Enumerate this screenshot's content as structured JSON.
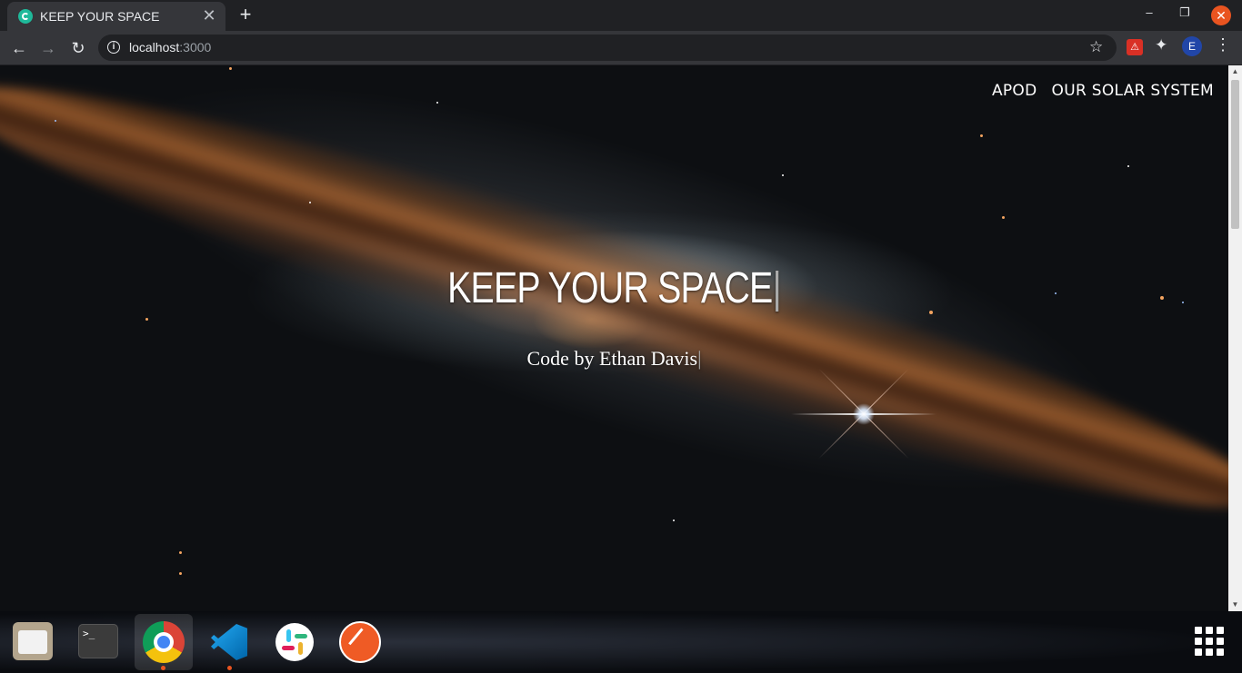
{
  "browser": {
    "tab_title": "KEEP YOUR SPACE",
    "tab_close": "✕",
    "new_tab": "+",
    "url_host": "localhost",
    "url_port": ":3000",
    "avatar_initial": "E",
    "win_minimize": "–",
    "win_restore": "❐",
    "win_close": "✕"
  },
  "nav": {
    "apod": "APOD",
    "solar_system": "OUR SOLAR SYSTEM"
  },
  "hero": {
    "title": "KEEP YOUR SPACE",
    "title_cursor": "|",
    "subtitle": "Code by Ethan Davis",
    "subtitle_cursor": "|"
  },
  "dock": {
    "items": [
      "files-icon",
      "terminal-icon",
      "chrome-icon",
      "vscode-icon",
      "slack-icon",
      "postman-icon",
      "app-grid-icon"
    ],
    "terminal_glyph": ">_"
  },
  "colors": {
    "ubuntu_orange": "#e95420",
    "chrome_dark": "#202124",
    "chrome_toolbar": "#35363a"
  }
}
